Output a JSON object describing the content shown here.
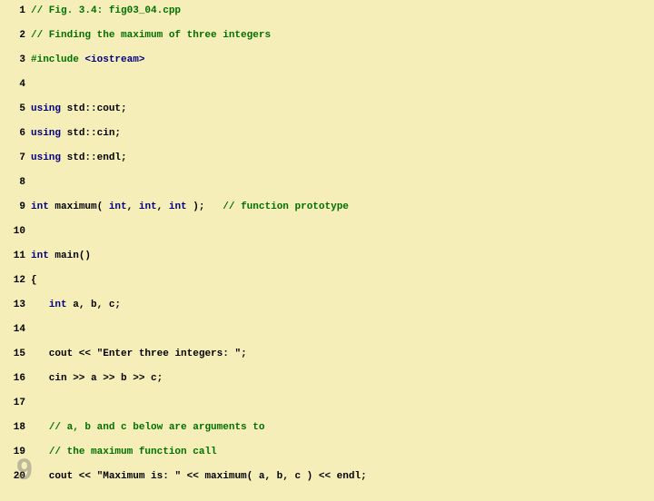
{
  "watermark": "9",
  "lines": [
    {
      "n": "1",
      "tokens": [
        {
          "cls": "comment",
          "t": "// Fig. 3.4: fig03_04.cpp"
        }
      ]
    },
    {
      "n": "2",
      "tokens": [
        {
          "cls": "comment",
          "t": "// Finding the maximum of three integers"
        }
      ]
    },
    {
      "n": "3",
      "tokens": [
        {
          "cls": "preproc",
          "t": "#include "
        },
        {
          "cls": "angled",
          "t": "<iostream>"
        }
      ]
    },
    {
      "n": "4",
      "tokens": []
    },
    {
      "n": "5",
      "tokens": [
        {
          "cls": "kw-blue",
          "t": "using"
        },
        {
          "cls": "txt",
          "t": " std::cout;"
        }
      ]
    },
    {
      "n": "6",
      "tokens": [
        {
          "cls": "kw-blue",
          "t": "using"
        },
        {
          "cls": "txt",
          "t": " std::cin;"
        }
      ]
    },
    {
      "n": "7",
      "tokens": [
        {
          "cls": "kw-blue",
          "t": "using"
        },
        {
          "cls": "txt",
          "t": " std::endl;"
        }
      ]
    },
    {
      "n": "8",
      "tokens": []
    },
    {
      "n": "9",
      "tokens": [
        {
          "cls": "kw-blue",
          "t": "int"
        },
        {
          "cls": "txt",
          "t": " maximum( "
        },
        {
          "cls": "kw-blue",
          "t": "int"
        },
        {
          "cls": "txt",
          "t": ", "
        },
        {
          "cls": "kw-blue",
          "t": "int"
        },
        {
          "cls": "txt",
          "t": ", "
        },
        {
          "cls": "kw-blue",
          "t": "int"
        },
        {
          "cls": "txt",
          "t": " );   "
        },
        {
          "cls": "comment",
          "t": "// function prototype"
        }
      ]
    },
    {
      "n": "10",
      "tokens": []
    },
    {
      "n": "11",
      "tokens": [
        {
          "cls": "kw-blue",
          "t": "int"
        },
        {
          "cls": "txt",
          "t": " main()"
        }
      ]
    },
    {
      "n": "12",
      "tokens": [
        {
          "cls": "txt",
          "t": "{"
        }
      ]
    },
    {
      "n": "13",
      "tokens": [
        {
          "cls": "txt",
          "t": "   "
        },
        {
          "cls": "kw-blue",
          "t": "int"
        },
        {
          "cls": "txt",
          "t": " a, b, c;"
        }
      ]
    },
    {
      "n": "14",
      "tokens": []
    },
    {
      "n": "15",
      "tokens": [
        {
          "cls": "txt",
          "t": "   cout << "
        },
        {
          "cls": "str",
          "t": "\"Enter three integers: \""
        },
        {
          "cls": "txt",
          "t": ";"
        }
      ]
    },
    {
      "n": "16",
      "tokens": [
        {
          "cls": "txt",
          "t": "   cin >> a >> b >> c;"
        }
      ]
    },
    {
      "n": "17",
      "tokens": []
    },
    {
      "n": "18",
      "tokens": [
        {
          "cls": "txt",
          "t": "   "
        },
        {
          "cls": "comment",
          "t": "// a, b and c below are arguments to"
        }
      ]
    },
    {
      "n": "19",
      "tokens": [
        {
          "cls": "txt",
          "t": "   "
        },
        {
          "cls": "comment",
          "t": "// the maximum function call"
        }
      ]
    },
    {
      "n": "20",
      "tokens": [
        {
          "cls": "txt",
          "t": "   cout << "
        },
        {
          "cls": "str",
          "t": "\"Maximum is: \""
        },
        {
          "cls": "txt",
          "t": " << maximum( a, b, c ) << endl;"
        }
      ]
    }
  ]
}
